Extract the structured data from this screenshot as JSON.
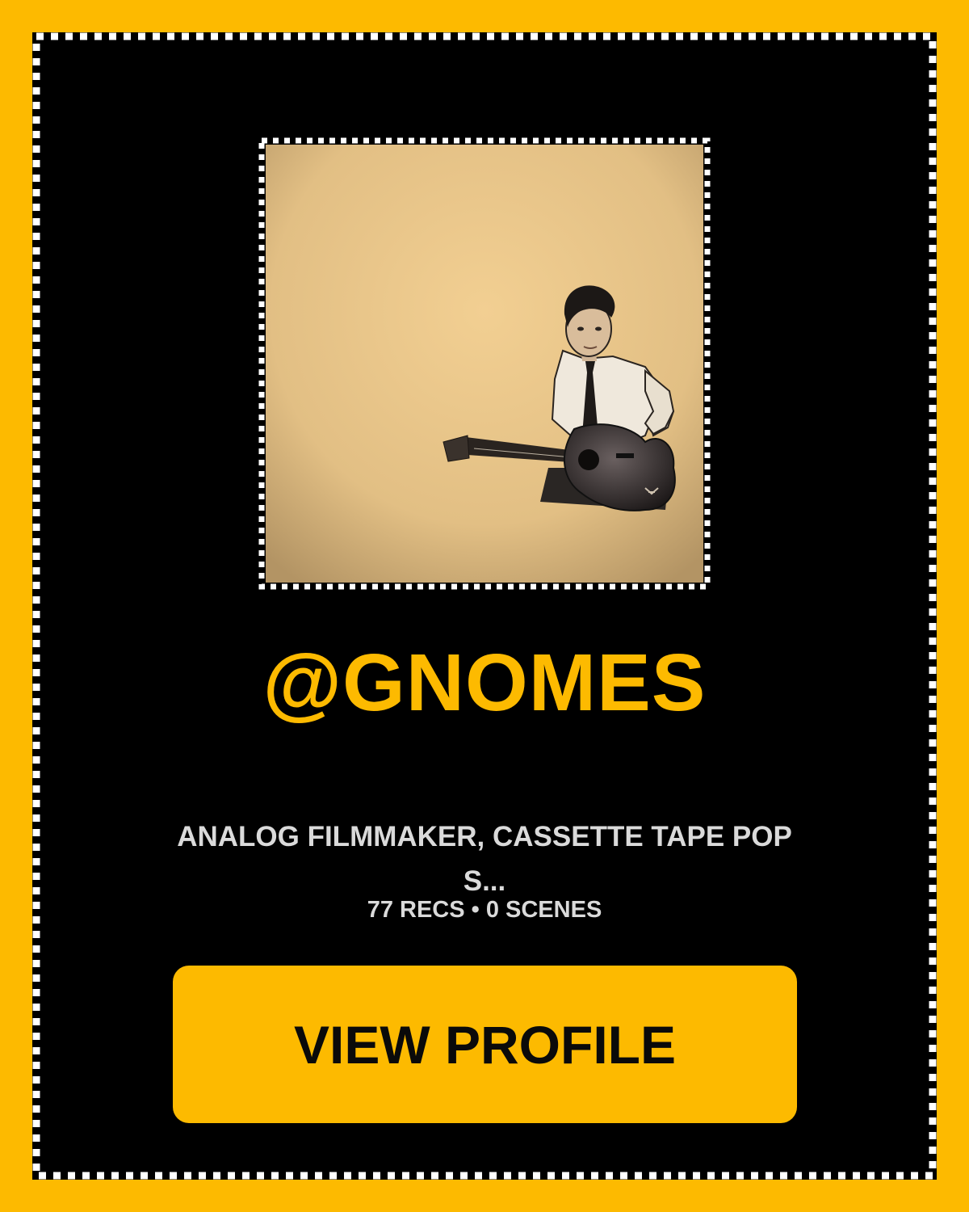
{
  "colors": {
    "accent": "#FDBA00",
    "card_background": "#000000",
    "text_muted": "#DADADA",
    "button_text": "#0A0A0A"
  },
  "profile": {
    "username": "@GNOMES",
    "bio": "ANALOG FILMMAKER, CASSETTE TAPE POP S...",
    "stats": "77 RECS • 0 SCENES",
    "avatar_icon": "avatar-photo-guitar-player"
  },
  "actions": {
    "view_profile_label": "VIEW PROFILE"
  }
}
